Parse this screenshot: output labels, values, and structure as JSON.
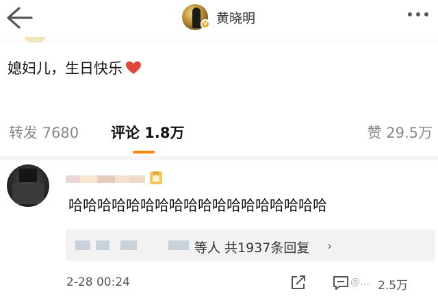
{
  "header": {
    "back_icon": "arrow-left-icon",
    "author_name": "黄晓明",
    "verified_badge": "V",
    "more_icon": "more-dots-icon"
  },
  "post": {
    "text": "媳妇儿，生日快乐",
    "emoji": "heart-icon",
    "emoji_color": "#e0483e"
  },
  "stats": {
    "repost": "转发 7680",
    "comment": "评论 1.8万",
    "like": "赞 29.5万",
    "active_tab": "comment",
    "accent_color": "#ff8200"
  },
  "comment": {
    "text": "哈哈哈哈哈哈哈哈哈哈哈哈哈哈哈哈哈哈",
    "replies_summary": "等人 共1937条回复",
    "replies_chevron": "›",
    "time": "2-28 00:24",
    "likes": "2.5万"
  },
  "watermark": "@…"
}
